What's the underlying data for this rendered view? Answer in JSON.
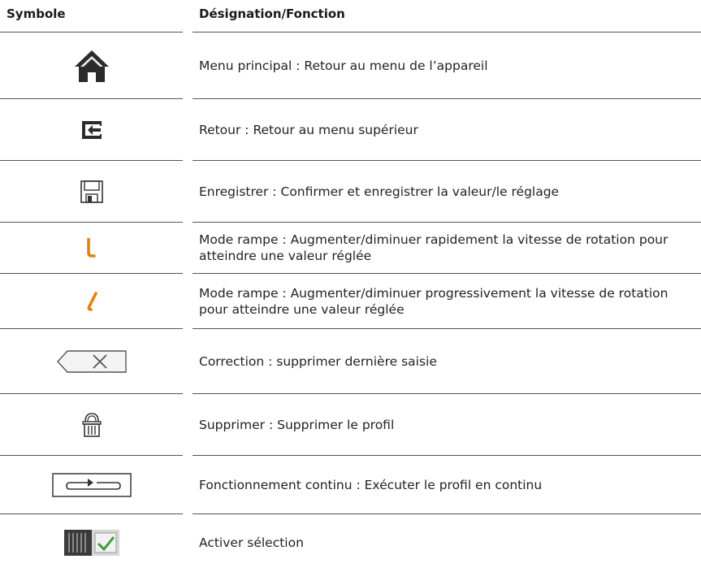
{
  "table": {
    "headers": {
      "symbol": "Symbole",
      "function": "Désignation/Fonction"
    },
    "rows": [
      {
        "icon": "home-icon",
        "text": "Menu principal : Retour au menu de l’appareil"
      },
      {
        "icon": "back-arrow-icon",
        "text": "Retour : Retour au menu supérieur"
      },
      {
        "icon": "save-disk-icon",
        "text": "Enregistrer : Confirmer et enregistrer la valeur/le réglage"
      },
      {
        "icon": "ramp-steep-icon",
        "text": "Mode rampe : Augmenter/diminuer rapidement la vitesse de rotation pour atteindre une valeur réglée"
      },
      {
        "icon": "ramp-gradual-icon",
        "text": "Mode rampe : Augmenter/diminuer progressivement la vitesse de rotation pour atteindre une valeur réglée"
      },
      {
        "icon": "backspace-icon",
        "text": "Correction : supprimer dernière saisie"
      },
      {
        "icon": "trash-icon",
        "text": "Supprimer : Supprimer le profil"
      },
      {
        "icon": "loop-icon",
        "text": "Fonctionnement continu : Exécuter le profil en continu"
      },
      {
        "icon": "activate-selection-icon",
        "text": "Activer sélection"
      }
    ]
  },
  "colors": {
    "accent": "#f07d00",
    "check": "#3aa03a",
    "icon": "#333333"
  }
}
